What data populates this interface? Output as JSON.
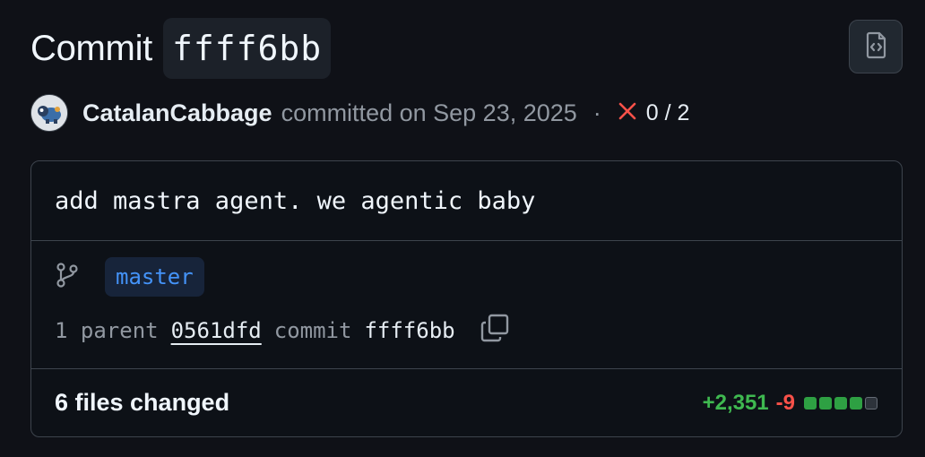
{
  "header": {
    "title_word": "Commit",
    "sha": "ffff6bb",
    "browse_icon": "file-code-icon"
  },
  "author_line": {
    "avatar_icon": "avatar-image",
    "author": "CatalanCabbage",
    "committed_text": "committed on Sep 23, 2025",
    "separator": "·",
    "check_icon": "x-icon",
    "check_count": "0 / 2",
    "colors": {
      "fail": "#f85149"
    }
  },
  "commit_box": {
    "message": "add mastra agent. we agentic baby",
    "branch_icon": "git-branch-icon",
    "branch": "master",
    "parent_label": "1 parent",
    "parent_sha": "0561dfd",
    "commit_label": "commit",
    "commit_sha": "ffff6bb",
    "copy_icon": "copy-icon"
  },
  "files": {
    "label": "6 files changed",
    "additions": "+2,351",
    "deletions": "-9",
    "diff_blocks": [
      "add",
      "add",
      "add",
      "add",
      "neutral"
    ],
    "colors": {
      "additions": "#3fb950",
      "deletions": "#f85149"
    }
  }
}
